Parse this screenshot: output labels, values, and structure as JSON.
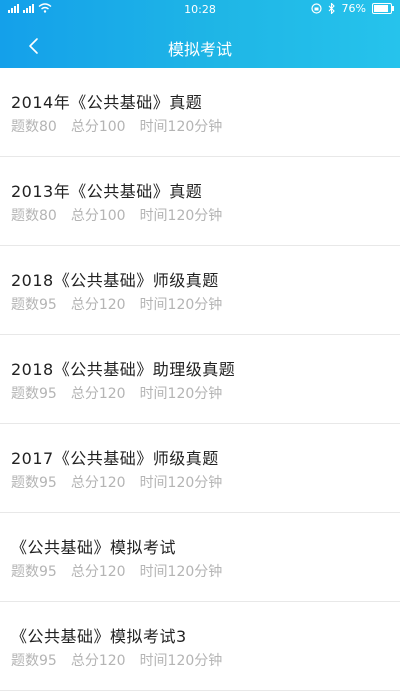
{
  "status_bar": {
    "signal": "4G",
    "time": "10:28",
    "battery": "76%",
    "battery_level": 0.76
  },
  "nav": {
    "title": "模拟考试"
  },
  "exams": [
    {
      "title": "2014年《公共基础》真题",
      "count": "题数80",
      "score": "总分100",
      "time": "时间120分钟"
    },
    {
      "title": "2013年《公共基础》真题",
      "count": "题数80",
      "score": "总分100",
      "time": "时间120分钟"
    },
    {
      "title": "2018《公共基础》师级真题",
      "count": "题数95",
      "score": "总分120",
      "time": "时间120分钟"
    },
    {
      "title": "2018《公共基础》助理级真题",
      "count": "题数95",
      "score": "总分120",
      "time": "时间120分钟"
    },
    {
      "title": "2017《公共基础》师级真题",
      "count": "题数95",
      "score": "总分120",
      "time": "时间120分钟"
    },
    {
      "title": "《公共基础》模拟考试",
      "count": "题数95",
      "score": "总分120",
      "time": "时间120分钟"
    },
    {
      "title": "《公共基础》模拟考试3",
      "count": "题数95",
      "score": "总分120",
      "time": "时间120分钟"
    }
  ]
}
